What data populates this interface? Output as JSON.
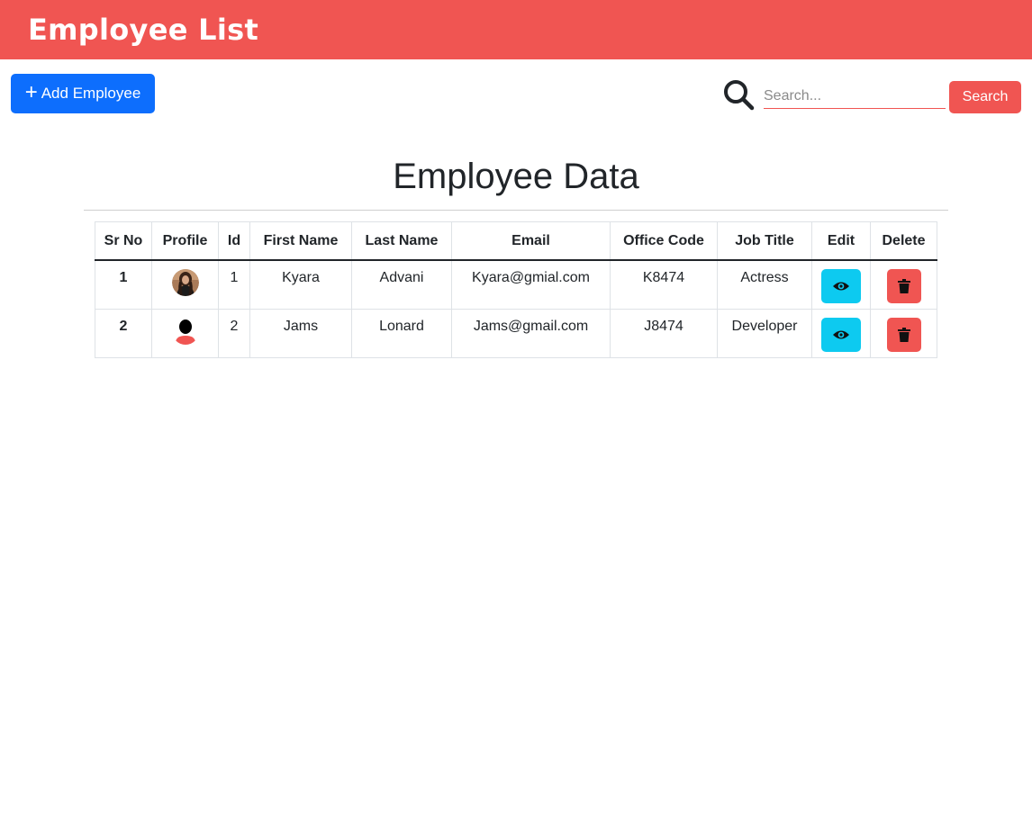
{
  "header": {
    "title": "Employee List"
  },
  "toolbar": {
    "add_label": "Add Employee",
    "search_placeholder": "Search...",
    "search_label": "Search"
  },
  "section": {
    "title": "Employee Data"
  },
  "table": {
    "headers": [
      "Sr No",
      "Profile",
      "Id",
      "First Name",
      "Last Name",
      "Email",
      "Office Code",
      "Job Title",
      "Edit",
      "Delete"
    ],
    "rows": [
      {
        "sr": "1",
        "profile": "photo-avatar",
        "id": "1",
        "first": "Kyara",
        "last": "Advani",
        "email": "Kyara@gmial.com",
        "office": "K8474",
        "job": "Actress"
      },
      {
        "sr": "2",
        "profile": "default-user-avatar",
        "id": "2",
        "first": "Jams",
        "last": "Lonard",
        "email": "Jams@gmail.com",
        "office": "J8474",
        "job": "Developer"
      }
    ]
  },
  "colors": {
    "header_bg": "#f05552",
    "primary": "#0d6efd",
    "info": "#0dcaf0",
    "danger": "#f05552"
  },
  "icons": {
    "search": "search-icon",
    "add": "plus-icon",
    "edit": "eye-icon",
    "delete": "trash-icon"
  }
}
